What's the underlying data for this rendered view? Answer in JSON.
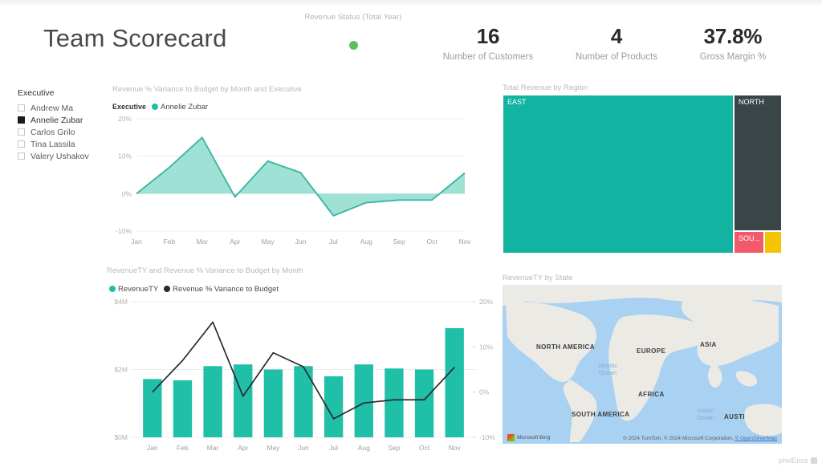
{
  "header": {
    "title": "Team Scorecard",
    "status_card": {
      "caption": "Revenue Status (Total Year)",
      "indicator": "green-status-dot",
      "color": "#5FBF5F"
    },
    "kpis": [
      {
        "value": "16",
        "caption": "Number of Customers"
      },
      {
        "value": "4",
        "caption": "Number of Products"
      },
      {
        "value": "37.8%",
        "caption": "Gross Margin %"
      }
    ]
  },
  "slicer": {
    "title": "Executive",
    "items": [
      {
        "label": "Andrew Ma",
        "checked": false
      },
      {
        "label": "Annelie Zubar",
        "checked": true
      },
      {
        "label": "Carlos Grilo",
        "checked": false
      },
      {
        "label": "Tina Lassila",
        "checked": false
      },
      {
        "label": "Valery Ushakov",
        "checked": false
      }
    ]
  },
  "theme": {
    "teal": "#1FBFA8",
    "area_fill": "#8FDCCF",
    "area_line": "#3CB6A4",
    "dark_slate": "#3A4548",
    "coral": "#F2596B",
    "yellow": "#F5C400",
    "green": "#5FBF5F",
    "line_dark": "#2B2B2B"
  },
  "chart_data": [
    {
      "id": "area",
      "type": "area",
      "title": "Revenue % Variance to Budget by Month and Executive",
      "legend_title": "Executive",
      "legend": [
        "Annelie Zubar"
      ],
      "legend_position": "top-left",
      "xlabel": "",
      "ylabel": "",
      "categories": [
        "Jan",
        "Feb",
        "Mar",
        "Apr",
        "May",
        "Jun",
        "Jul",
        "Aug",
        "Sep",
        "Oct",
        "Nov"
      ],
      "ytick_labels": [
        "20%",
        "10%",
        "0%",
        "-10%"
      ],
      "ylim": [
        -10,
        20
      ],
      "grid": true,
      "series": [
        {
          "name": "Annelie Zubar",
          "values": [
            0.0,
            7.0,
            15.0,
            -0.9,
            8.7,
            5.6,
            -5.9,
            -2.4,
            -1.7,
            -1.7,
            5.5
          ]
        }
      ]
    },
    {
      "id": "treemap",
      "type": "treemap",
      "title": "Total Revenue by Region",
      "categories": [
        "EAST",
        "NORTH",
        "SOU...",
        ""
      ],
      "values": [
        78.5,
        16.5,
        3.3,
        1.7
      ],
      "colors": [
        "#12B3A0",
        "#3A4548",
        "#F2596B",
        "#F5C400"
      ]
    },
    {
      "id": "combo",
      "type": "bar",
      "title": "RevenueTY and Revenue % Variance to Budget by Month",
      "legend": [
        "RevenueTY",
        "Revenue % Variance to Budget"
      ],
      "legend_position": "top-left",
      "categories": [
        "Jan",
        "Feb",
        "Mar",
        "Apr",
        "May",
        "Jun",
        "Jul",
        "Aug",
        "Sep",
        "Oct",
        "Nov"
      ],
      "y_left_ticks": [
        "$4M",
        "$2M",
        "$0M"
      ],
      "y_left_lim": [
        0,
        4
      ],
      "y_right_ticks": [
        "20%",
        "10%",
        "0%",
        "-10%"
      ],
      "y_right_lim": [
        -10,
        20
      ],
      "grid": true,
      "series": [
        {
          "name": "RevenueTY",
          "type": "bar",
          "axis": "left",
          "values": [
            1.72,
            1.68,
            2.1,
            2.15,
            2.0,
            2.1,
            1.8,
            2.15,
            2.03,
            2.0,
            3.22
          ]
        },
        {
          "name": "Revenue % Variance to Budget",
          "type": "line",
          "axis": "right",
          "values": [
            0.0,
            7.0,
            15.5,
            -0.9,
            8.7,
            5.6,
            -5.9,
            -2.4,
            -1.7,
            -1.7,
            5.5
          ]
        }
      ]
    },
    {
      "id": "map",
      "type": "map",
      "title": "RevenueTY by State",
      "continent_labels": [
        "NORTH AMERICA",
        "EUROPE",
        "ASIA",
        "AFRICA",
        "SOUTH AMERICA",
        "AUSTI"
      ],
      "ocean_labels": [
        "Atlantic Ocean",
        "Indian Ocean"
      ],
      "provider_logo": "Microsoft Bing",
      "attribution": "© 2024 TomTom, © 2024 Microsoft Corporation, ",
      "attribution_link": "© OpenStreetMap"
    }
  ],
  "watermark": {
    "text": "phvlEnce"
  }
}
